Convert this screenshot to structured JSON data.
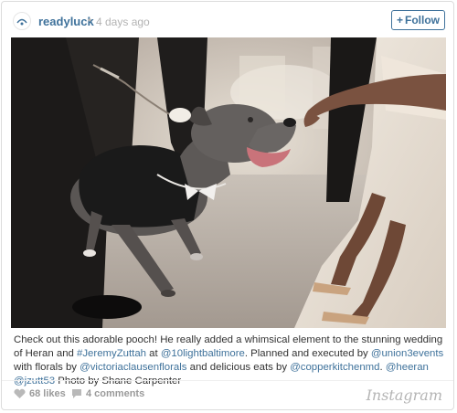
{
  "post": {
    "username": "readyluck",
    "separator": "•",
    "time": "4 days ago",
    "follow_label": "Follow",
    "follow_icon": "plus-icon"
  },
  "caption": {
    "parts": [
      {
        "text": "Check out this adorable pooch! He really added a whimsical element to the stunning wedding of Heran and ",
        "link": false
      },
      {
        "text": "#JeremyZuttah",
        "link": true
      },
      {
        "text": " at ",
        "link": false
      },
      {
        "text": "@10lightbaltimore",
        "link": true
      },
      {
        "text": ". Planned and executed by ",
        "link": false
      },
      {
        "text": "@union3events",
        "link": true
      },
      {
        "text": " with florals by ",
        "link": false
      },
      {
        "text": "@victoriaclausenflorals",
        "link": true
      },
      {
        "text": " and delicious eats by ",
        "link": false
      },
      {
        "text": "@copperkitchenmd",
        "link": true
      },
      {
        "text": ". ",
        "link": false
      },
      {
        "text": "@heeran",
        "link": true
      },
      {
        "text": " ",
        "link": false
      },
      {
        "text": "@jzutt53",
        "link": true
      },
      {
        "text": " Photo by Shane Carpenter",
        "link": false
      }
    ]
  },
  "footer": {
    "likes": "68 likes",
    "comments": "4 comments",
    "brand": "Instagram"
  },
  "colors": {
    "link": "#3f729b",
    "muted": "#b3b3b3"
  }
}
